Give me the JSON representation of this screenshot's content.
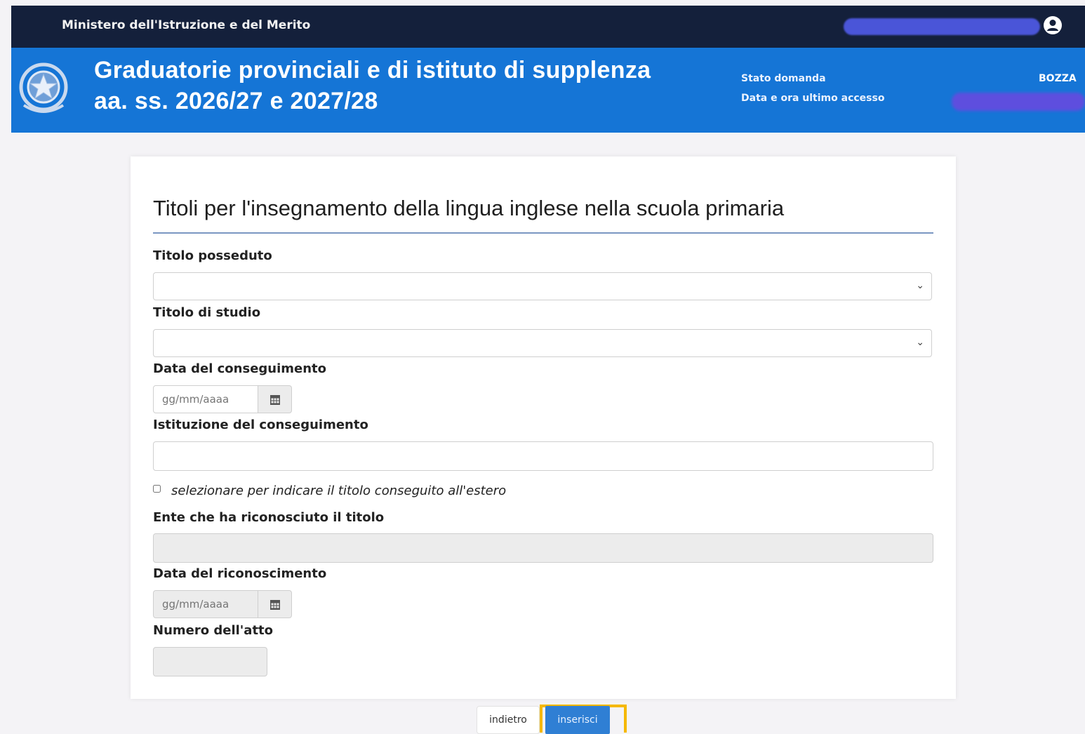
{
  "topbar": {
    "ministry": "Ministero dell'Istruzione e del Merito",
    "user_icon": "user-circle-icon"
  },
  "header": {
    "title_line1": "Graduatorie provinciali e di istituto di supplenza",
    "title_line2": "aa. ss. 2026/27 e 2027/28",
    "status_label": "Stato domanda",
    "status_value": "BOZZA",
    "last_access_label": "Data e ora ultimo accesso",
    "emblem": "italian-republic-emblem"
  },
  "form": {
    "heading": "Titoli per l'insegnamento della lingua inglese nella scuola primaria",
    "titolo_posseduto_label": "Titolo posseduto",
    "titolo_posseduto_value": "",
    "titolo_studio_label": "Titolo di studio",
    "titolo_studio_value": "",
    "data_conseguimento_label": "Data del conseguimento",
    "data_conseguimento_placeholder": "gg/mm/aaaa",
    "istituzione_label": "Istituzione del conseguimento",
    "estero_checkbox_label": "selezionare per indicare il titolo conseguito all'estero",
    "ente_label": "Ente che ha riconosciuto il titolo",
    "data_riconoscimento_label": "Data del riconoscimento",
    "data_riconoscimento_placeholder": "gg/mm/aaaa",
    "numero_atto_label": "Numero dell'atto"
  },
  "actions": {
    "back": "indietro",
    "insert": "inserisci",
    "highlight_color": "#f5b800"
  },
  "colors": {
    "topbar": "#14203b",
    "header": "#1575d6",
    "primary_button": "#2f7fd4"
  }
}
